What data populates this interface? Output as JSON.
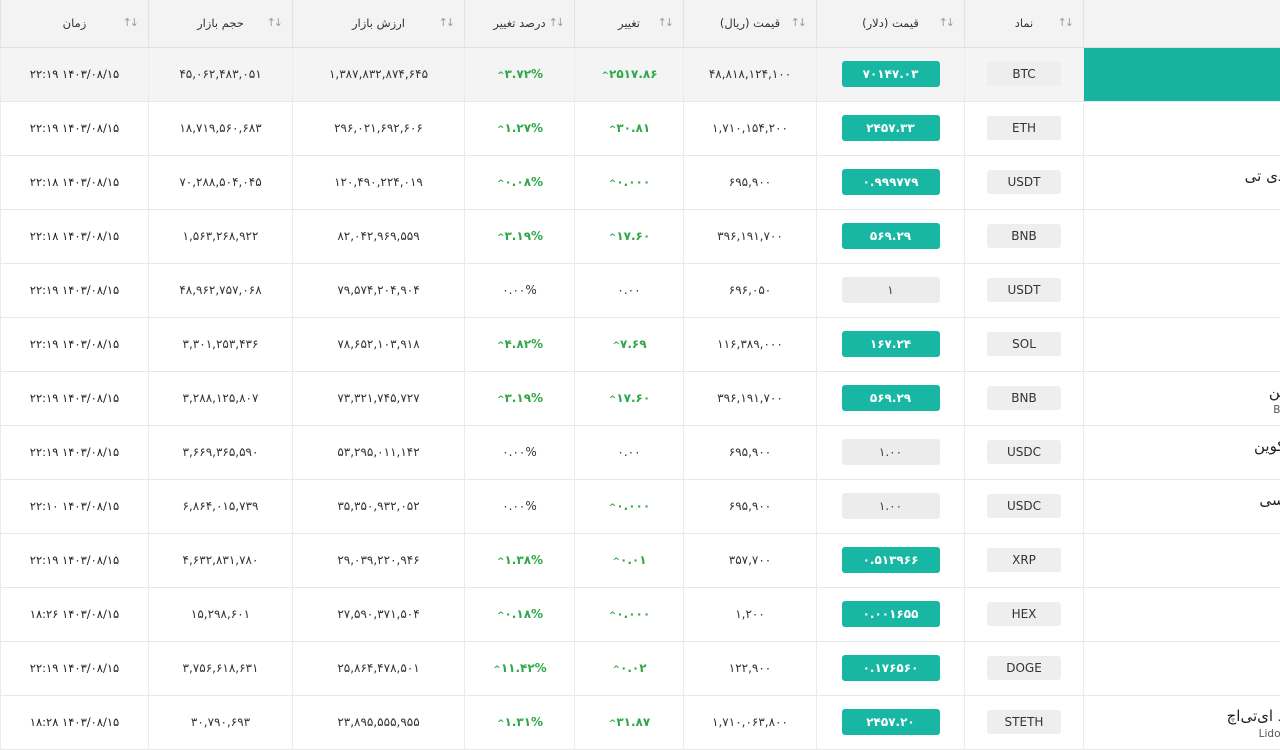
{
  "headers": {
    "time": "زمان",
    "volume": "حجم بازار",
    "market_cap": "ارزش بازار",
    "change_pct": "درصد تغییر",
    "change": "تغییر",
    "price_rial": "قیمت (ریال)",
    "price_usd": "قیمت (دلار)",
    "symbol": "نماد"
  },
  "sort_icon": "sort-arrows-icon",
  "colors": {
    "accent": "#17b7a3",
    "positive": "#2ea84a"
  },
  "rows": [
    {
      "time": "۲۲:۱۹ ۱۴۰۳/۰۸/۱۵",
      "volume": "۴۵,۰۶۲,۴۸۳,۰۵۱",
      "market_cap": "۱,۳۸۷,۸۳۲,۸۷۴,۶۴۵",
      "change_pct": "۳.۷۲%",
      "change": "۲۵۱۷.۸۶",
      "price_rial": "۴۸,۸۱۸,۱۲۴,۱۰۰",
      "price_usd": "۷۰۱۴۷.۰۳",
      "symbol": "BTC",
      "name": "",
      "sub": ""
    },
    {
      "time": "۲۲:۱۹ ۱۴۰۳/۰۸/۱۵",
      "volume": "۱۸,۷۱۹,۵۶۰,۶۸۳",
      "market_cap": "۲۹۶,۰۲۱,۶۹۲,۶۰۶",
      "change_pct": "۱.۲۷%",
      "change": "۳۰.۸۱",
      "price_rial": "۱,۷۱۰,۱۵۴,۲۰۰",
      "price_usd": "۲۴۵۷.۳۳",
      "symbol": "ETH",
      "name": "",
      "sub": ""
    },
    {
      "time": "۲۲:۱۸ ۱۴۰۳/۰۸/۱۵",
      "volume": "۷۰,۲۸۸,۵۰۴,۰۴۵",
      "market_cap": "۱۲۰,۴۹۰,۲۲۴,۰۱۹",
      "change_pct": "۰.۰۸%",
      "change": "۰.۰۰۰",
      "price_rial": "۶۹۵,۹۰۰",
      "price_usd": "۰.۹۹۹۷۷۹",
      "symbol": "USDT",
      "name": "دی تی",
      "sub": ""
    },
    {
      "time": "۲۲:۱۸ ۱۴۰۳/۰۸/۱۵",
      "volume": "۱,۵۶۳,۲۶۸,۹۲۲",
      "market_cap": "۸۲,۰۴۲,۹۶۹,۵۵۹",
      "change_pct": "۳.۱۹%",
      "change": "۱۷.۶۰",
      "price_rial": "۳۹۶,۱۹۱,۷۰۰",
      "price_usd": "۵۶۹.۲۹",
      "symbol": "BNB",
      "name": "",
      "sub": ""
    },
    {
      "time": "۲۲:۱۹ ۱۴۰۳/۰۸/۱۵",
      "volume": "۴۸,۹۶۲,۷۵۷,۰۶۸",
      "market_cap": "۷۹,۵۷۴,۲۰۴,۹۰۴",
      "change_pct": "۰.۰۰%",
      "change": "۰.۰۰",
      "price_rial": "۶۹۶,۰۵۰",
      "price_usd": "۱",
      "symbol": "USDT",
      "name": "",
      "sub": ""
    },
    {
      "time": "۲۲:۱۹ ۱۴۰۳/۰۸/۱۵",
      "volume": "۳,۳۰۱,۲۵۳,۴۳۶",
      "market_cap": "۷۸,۶۵۲,۱۰۳,۹۱۸",
      "change_pct": "۴.۸۲%",
      "change": "۷.۶۹",
      "price_rial": "۱۱۶,۳۸۹,۰۰۰",
      "price_usd": "۱۶۷.۲۴",
      "symbol": "SOL",
      "name": "",
      "sub": ""
    },
    {
      "time": "۲۲:۱۹ ۱۴۰۳/۰۸/۱۵",
      "volume": "۳,۲۸۸,۱۲۵,۸۰۷",
      "market_cap": "۷۳,۳۲۱,۷۴۵,۷۲۷",
      "change_pct": "۳.۱۹%",
      "change": "۱۷.۶۰",
      "price_rial": "۳۹۶,۱۹۱,۷۰۰",
      "price_usd": "۵۶۹.۲۹",
      "symbol": "BNB",
      "name": "ین",
      "sub": "B"
    },
    {
      "time": "۲۲:۱۹ ۱۴۰۳/۰۸/۱۵",
      "volume": "۳,۶۶۹,۳۶۵,۵۹۰",
      "market_cap": "۵۳,۲۹۵,۰۱۱,۱۴۲",
      "change_pct": "۰.۰۰%",
      "change": "۰.۰۰",
      "price_rial": "۶۹۵,۹۰۰",
      "price_usd": "۱.۰۰",
      "symbol": "USDC",
      "name": "کوین",
      "sub": ""
    },
    {
      "time": "۲۲:۱۰ ۱۴۰۳/۰۸/۱۵",
      "volume": "۶,۸۶۴,۰۱۵,۷۳۹",
      "market_cap": "۳۵,۳۵۰,۹۳۲,۰۵۲",
      "change_pct": "۰.۰۰%",
      "change": "۰.۰۰۰",
      "price_rial": "۶۹۵,۹۰۰",
      "price_usd": "۱.۰۰",
      "symbol": "USDC",
      "name": "سی",
      "sub": ""
    },
    {
      "time": "۲۲:۱۹ ۱۴۰۳/۰۸/۱۵",
      "volume": "۴,۶۳۲,۸۳۱,۷۸۰",
      "market_cap": "۲۹,۰۳۹,۲۲۰,۹۴۶",
      "change_pct": "۱.۳۸%",
      "change": "۰.۰۱",
      "price_rial": "۳۵۷,۷۰۰",
      "price_usd": "۰.۵۱۳۹۶۶",
      "symbol": "XRP",
      "name": "",
      "sub": ""
    },
    {
      "time": "۱۸:۲۶ ۱۴۰۳/۰۸/۱۵",
      "volume": "۱۵,۲۹۸,۶۰۱",
      "market_cap": "۲۷,۵۹۰,۳۷۱,۵۰۴",
      "change_pct": "۰.۱۸%",
      "change": "۰.۰۰۰",
      "price_rial": "۱,۲۰۰",
      "price_usd": "۰.۰۰۱۶۵۵",
      "symbol": "HEX",
      "name": "",
      "sub": ""
    },
    {
      "time": "۲۲:۱۹ ۱۴۰۳/۰۸/۱۵",
      "volume": "۳,۷۵۶,۶۱۸,۶۳۱",
      "market_cap": "۲۵,۸۶۴,۴۷۸,۵۰۱",
      "change_pct": "۱۱.۴۲%",
      "change": "۰.۰۲",
      "price_rial": "۱۲۲,۹۰۰",
      "price_usd": "۰.۱۷۶۵۶۰",
      "symbol": "DOGE",
      "name": "",
      "sub": ""
    },
    {
      "time": "۱۸:۲۸ ۱۴۰۳/۰۸/۱۵",
      "volume": "۳۰,۷۹۰,۶۹۳",
      "market_cap": "۲۳,۸۹۵,۵۵۵,۹۵۵",
      "change_pct": "۱.۳۱%",
      "change": "۳۱.۸۷",
      "price_rial": "۱,۷۱۰,۰۶۳,۸۰۰",
      "price_usd": "۲۴۵۷.۲۰",
      "symbol": "STETH",
      "name": "د ای‌تی‌اچ",
      "sub": "Lido"
    }
  ]
}
